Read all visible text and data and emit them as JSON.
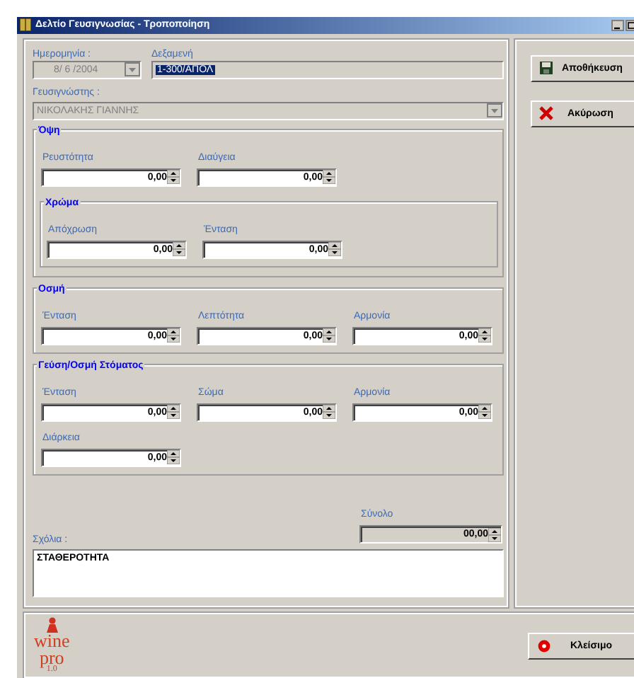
{
  "window": {
    "title": "Δελτίο Γευσιγνωσίας - Τροποποίηση"
  },
  "header": {
    "date": {
      "label": "Ημερομηνία :",
      "value": "8/ 6 /2004",
      "disabled": true
    },
    "tank": {
      "label": "Δεξαμενή",
      "value": "1-300/ΑΠΟΛ",
      "selected": true
    },
    "taster": {
      "label": "Γευσιγνώστης :",
      "value": "ΝΙΚΟΛΑΚΗΣ ΓΙΑΝΝΗΣ",
      "disabled": true
    }
  },
  "groups": [
    {
      "title": "Όψη",
      "fields": [
        {
          "label": "Ρευστότητα",
          "value": "0,00"
        },
        {
          "label": "Διαύγεια",
          "value": "0,00"
        }
      ],
      "subgroups": [
        {
          "title": "Χρώμα",
          "fields": [
            {
              "label": "Απόχρωση",
              "value": "0,00"
            },
            {
              "label": "Ένταση",
              "value": "0,00"
            }
          ]
        }
      ]
    },
    {
      "title": "Οσμή",
      "fields": [
        {
          "label": "Ένταση",
          "value": "0,00"
        },
        {
          "label": "Λεπτότητα",
          "value": "0,00"
        },
        {
          "label": "Αρμονία",
          "value": "0,00"
        }
      ]
    },
    {
      "title": "Γεύση/Οσμή Στόματος",
      "fields": [
        {
          "label": "Ένταση",
          "value": "0,00"
        },
        {
          "label": "Σώμα",
          "value": "0,00"
        },
        {
          "label": "Αρμονία",
          "value": "0,00"
        },
        {
          "label": "Διάρκεια",
          "value": "0,00"
        }
      ]
    }
  ],
  "total": {
    "label": "Σύνολο",
    "value": "00,00"
  },
  "comments": {
    "label": "Σχόλια :",
    "value": "ΣΤΑΘΕΡΟΤΗΤΑ"
  },
  "actions": [
    {
      "kind": "save",
      "label": "Αποθήκευση"
    },
    {
      "kind": "cancel",
      "label": "Ακύρωση"
    }
  ],
  "logo": {
    "word1": "wine",
    "word2": "pro",
    "version": "1.0"
  },
  "close_button": {
    "label": "Κλείσιμο"
  }
}
